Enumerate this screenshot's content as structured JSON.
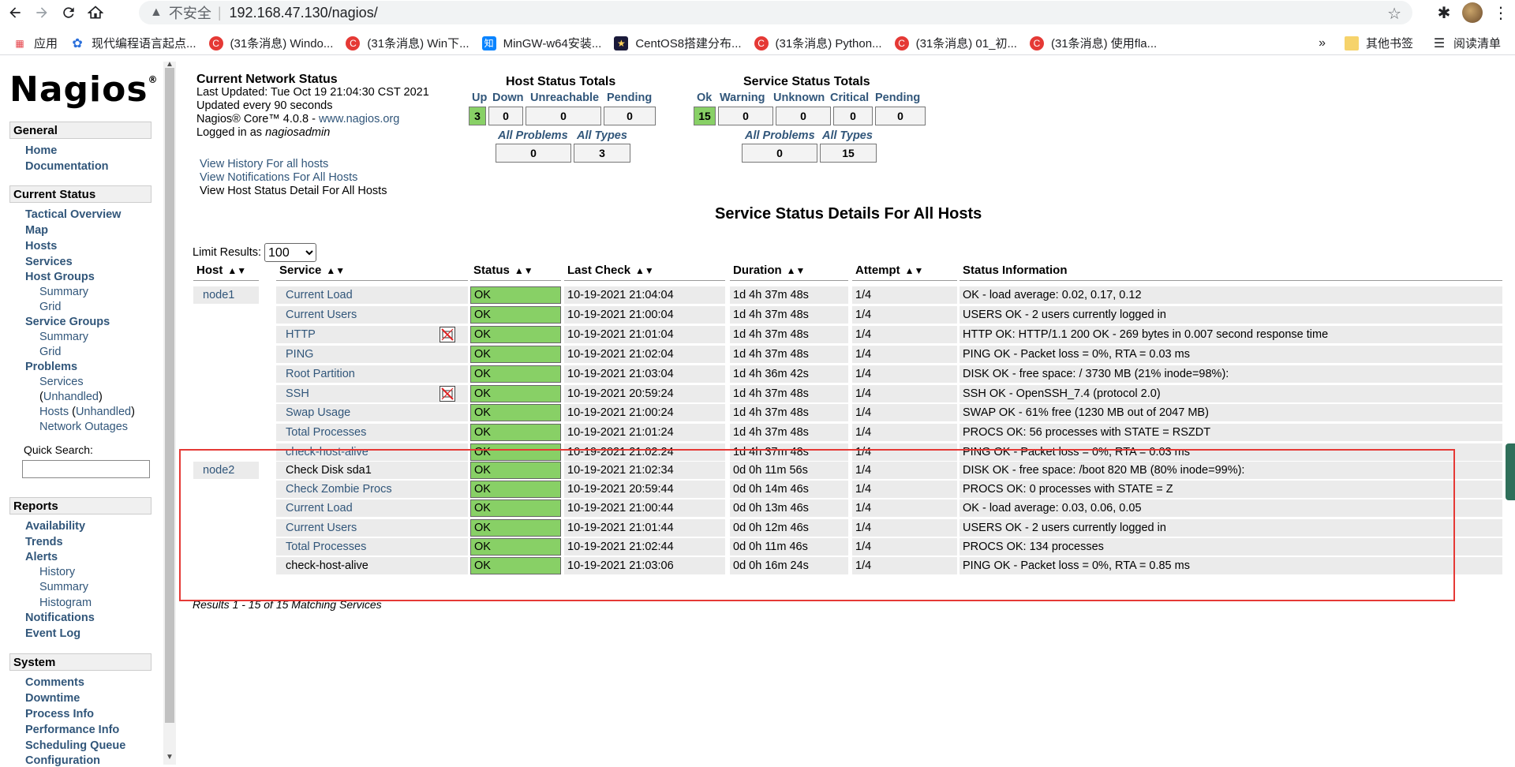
{
  "browser": {
    "insecure_label": "不安全",
    "url": "192.168.47.130/nagios/",
    "bookmarks": [
      {
        "label": "应用",
        "icon": "apps-grid-icon"
      },
      {
        "label": "现代编程语言起点...",
        "icon": "paw-icon"
      },
      {
        "label": "(31条消息) Windo...",
        "icon": "csdn-icon"
      },
      {
        "label": "(31条消息) Win下...",
        "icon": "csdn-icon"
      },
      {
        "label": "MinGW-w64安装...",
        "icon": "zhihu-icon"
      },
      {
        "label": "CentOS8搭建分布...",
        "icon": "centos-icon"
      },
      {
        "label": "(31条消息) Python...",
        "icon": "csdn-icon"
      },
      {
        "label": "(31条消息) 01_初...",
        "icon": "csdn-icon"
      },
      {
        "label": "(31条消息) 使用fla...",
        "icon": "csdn-icon"
      }
    ],
    "more": "»",
    "other_bookmarks": "其他书签",
    "reading_list": "阅读清单"
  },
  "sidebar": {
    "logo": "Nagios",
    "logo_mark": "®",
    "general": "General",
    "home": "Home",
    "documentation": "Documentation",
    "current_status": "Current Status",
    "tactical": "Tactical Overview",
    "map": "Map",
    "hosts": "Hosts",
    "services": "Services",
    "host_groups": "Host Groups",
    "hg_summary": "Summary",
    "hg_grid": "Grid",
    "service_groups": "Service Groups",
    "sg_summary": "Summary",
    "sg_grid": "Grid",
    "problems": "Problems",
    "p_services": "Services",
    "p_unhandled_1": "Unhandled",
    "p_hosts": "Hosts",
    "p_unhandled_2": "Unhandled",
    "p_outages": "Network Outages",
    "quick_search": "Quick Search:",
    "reports": "Reports",
    "availability": "Availability",
    "trends": "Trends",
    "alerts": "Alerts",
    "a_history": "History",
    "a_summary": "Summary",
    "a_histogram": "Histogram",
    "notifications": "Notifications",
    "event_log": "Event Log",
    "system": "System",
    "comments": "Comments",
    "downtime": "Downtime",
    "process_info": "Process Info",
    "performance_info": "Performance Info",
    "scheduling_queue": "Scheduling Queue",
    "configuration": "Configuration"
  },
  "status": {
    "title": "Current Network Status",
    "last_updated": "Last Updated: Tue Oct 19 21:04:30 CST 2021",
    "updated_every": "Updated every 90 seconds",
    "core_prefix": "Nagios® Core™ 4.0.8 - ",
    "core_link": "www.nagios.org",
    "logged_prefix": "Logged in as ",
    "logged_user": "nagiosadmin",
    "link_history": "View History For all hosts",
    "link_notifications": "View Notifications For All Hosts",
    "link_detail": "View Host Status Detail For All Hosts"
  },
  "host_totals": {
    "title": "Host Status Totals",
    "labels": [
      "Up",
      "Down",
      "Unreachable",
      "Pending"
    ],
    "values": [
      "3",
      "0",
      "0",
      "0"
    ],
    "all_problems": "All Problems",
    "all_types": "All Types",
    "problems_value": "0",
    "types_value": "3"
  },
  "service_totals": {
    "title": "Service Status Totals",
    "labels": [
      "Ok",
      "Warning",
      "Unknown",
      "Critical",
      "Pending"
    ],
    "values": [
      "15",
      "0",
      "0",
      "0",
      "0"
    ],
    "all_problems": "All Problems",
    "all_types": "All Types",
    "problems_value": "0",
    "types_value": "15"
  },
  "page_title": "Service Status Details For All Hosts",
  "limit_label": "Limit Results:",
  "limit_value": "100",
  "columns": [
    "Host",
    "Service",
    "Status",
    "Last Check",
    "Duration",
    "Attempt",
    "Status Information"
  ],
  "rows": [
    {
      "host": "node1",
      "service": "Current Load",
      "status": "OK",
      "last": "10-19-2021 21:04:04",
      "dur": "1d 4h 37m 48s",
      "att": "1/4",
      "info": "OK - load average: 0.02, 0.17, 0.12",
      "flap": false
    },
    {
      "host": "",
      "service": "Current Users",
      "status": "OK",
      "last": "10-19-2021 21:00:04",
      "dur": "1d 4h 37m 48s",
      "att": "1/4",
      "info": "USERS OK - 2 users currently logged in",
      "flap": false
    },
    {
      "host": "",
      "service": "HTTP",
      "status": "OK",
      "last": "10-19-2021 21:01:04",
      "dur": "1d 4h 37m 48s",
      "att": "1/4",
      "info": "HTTP OK: HTTP/1.1 200 OK - 269 bytes in 0.007 second response time",
      "flap": true
    },
    {
      "host": "",
      "service": "PING",
      "status": "OK",
      "last": "10-19-2021 21:02:04",
      "dur": "1d 4h 37m 48s",
      "att": "1/4",
      "info": "PING OK - Packet loss = 0%, RTA = 0.03 ms",
      "flap": false
    },
    {
      "host": "",
      "service": "Root Partition",
      "status": "OK",
      "last": "10-19-2021 21:03:04",
      "dur": "1d 4h 36m 42s",
      "att": "1/4",
      "info": "DISK OK - free space: / 3730 MB (21% inode=98%):",
      "flap": false
    },
    {
      "host": "",
      "service": "SSH",
      "status": "OK",
      "last": "10-19-2021 20:59:24",
      "dur": "1d 4h 37m 48s",
      "att": "1/4",
      "info": "SSH OK - OpenSSH_7.4 (protocol 2.0)",
      "flap": true
    },
    {
      "host": "",
      "service": "Swap Usage",
      "status": "OK",
      "last": "10-19-2021 21:00:24",
      "dur": "1d 4h 37m 48s",
      "att": "1/4",
      "info": "SWAP OK - 61% free (1230 MB out of 2047 MB)",
      "flap": false
    },
    {
      "host": "",
      "service": "Total Processes",
      "status": "OK",
      "last": "10-19-2021 21:01:24",
      "dur": "1d 4h 37m 48s",
      "att": "1/4",
      "info": "PROCS OK: 56 processes with STATE = RSZDT",
      "flap": false
    },
    {
      "host": "",
      "service": "check-host-alive",
      "status": "OK",
      "last": "10-19-2021 21:02:24",
      "dur": "1d 4h 37m 48s",
      "att": "1/4",
      "info": "PING OK - Packet loss = 0%, RTA = 0.03 ms",
      "flap": false
    },
    {
      "host": "node2",
      "service": "Check Disk sda1",
      "status": "OK",
      "last": "10-19-2021 21:02:34",
      "dur": "0d 0h 11m 56s",
      "att": "1/4",
      "info": "DISK OK - free space: /boot 820 MB (80% inode=99%):",
      "flap": false
    },
    {
      "host": "",
      "service": "Check Zombie Procs",
      "status": "OK",
      "last": "10-19-2021 20:59:44",
      "dur": "0d 0h 14m 46s",
      "att": "1/4",
      "info": "PROCS OK: 0 processes with STATE = Z",
      "flap": false
    },
    {
      "host": "",
      "service": "Current Load",
      "status": "OK",
      "last": "10-19-2021 21:00:44",
      "dur": "0d 0h 13m 46s",
      "att": "1/4",
      "info": "OK - load average: 0.03, 0.06, 0.05",
      "flap": false
    },
    {
      "host": "",
      "service": "Current Users",
      "status": "OK",
      "last": "10-19-2021 21:01:44",
      "dur": "0d 0h 12m 46s",
      "att": "1/4",
      "info": "USERS OK - 2 users currently logged in",
      "flap": false
    },
    {
      "host": "",
      "service": "Total Processes",
      "status": "OK",
      "last": "10-19-2021 21:02:44",
      "dur": "0d 0h 11m 46s",
      "att": "1/4",
      "info": "PROCS OK: 134 processes",
      "flap": false
    },
    {
      "host": "",
      "service": "check-host-alive",
      "status": "OK",
      "last": "10-19-2021 21:03:06",
      "dur": "0d 0h 16m 24s",
      "att": "1/4",
      "info": "PING OK - Packet loss = 0%, RTA = 0.85 ms",
      "flap": false
    }
  ],
  "results": "Results 1 - 15 of 15 Matching Services",
  "colors": {
    "ok_green": "#88d066",
    "link_blue": "#31567a",
    "annotation_red": "#e53935"
  }
}
